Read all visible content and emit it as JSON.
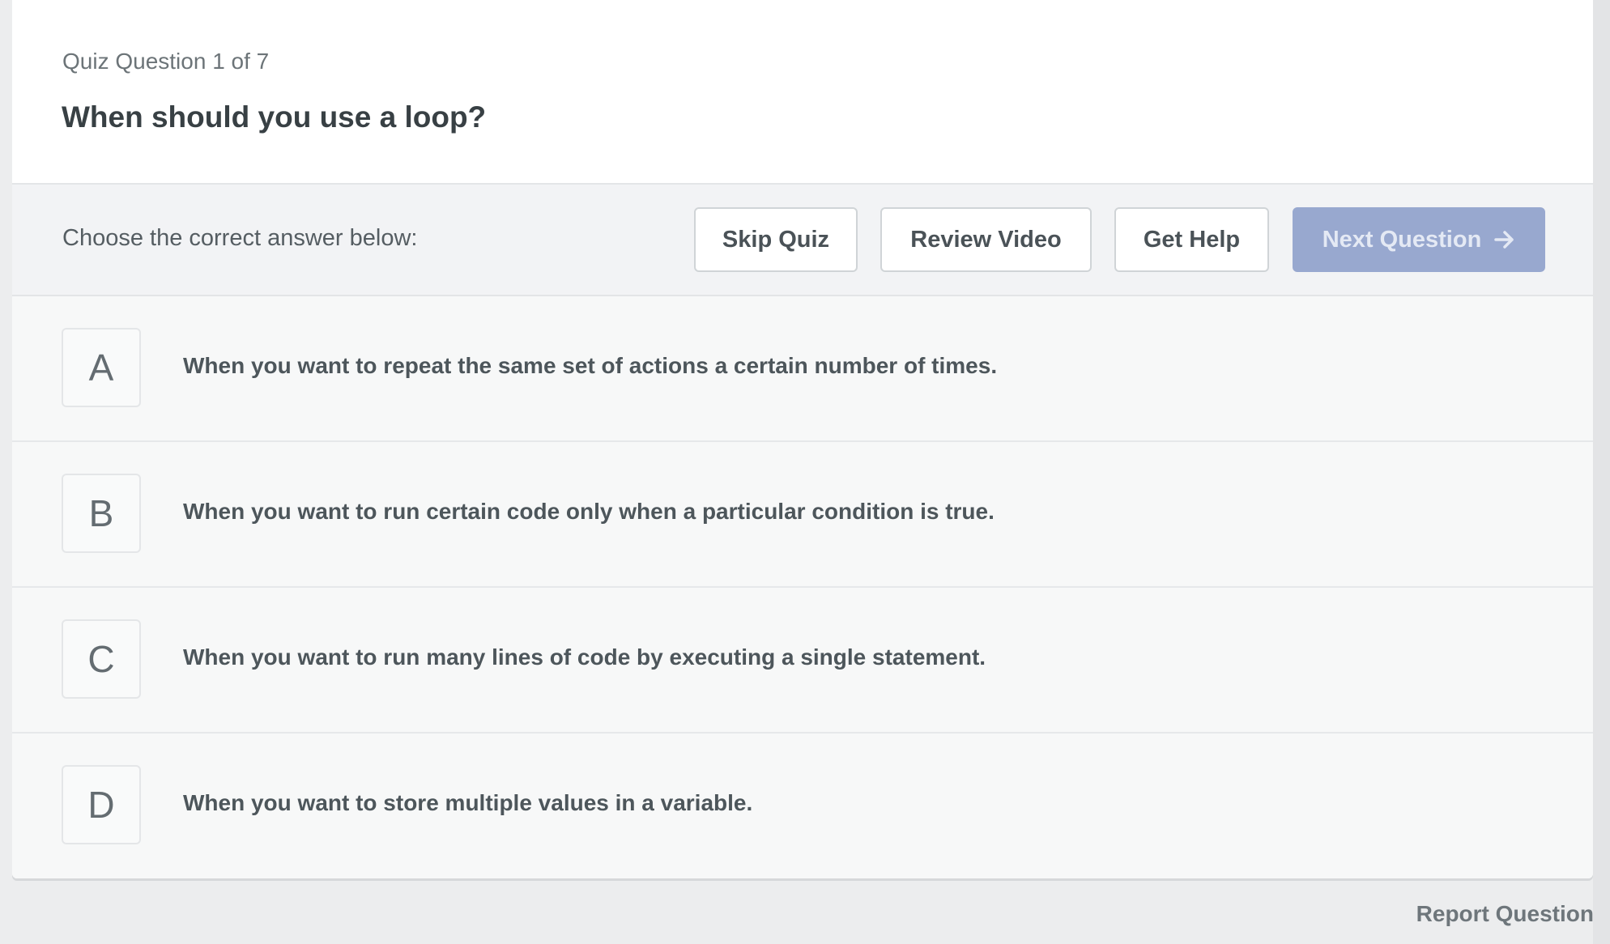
{
  "quiz": {
    "counter": "Quiz Question 1 of 7",
    "question": "When should you use a loop?"
  },
  "toolbar": {
    "prompt": "Choose the correct answer below:",
    "skip_label": "Skip Quiz",
    "review_label": "Review Video",
    "help_label": "Get Help",
    "next_label": "Next Question",
    "next_icon": "arrow-right-icon",
    "next_disabled": true
  },
  "options": [
    {
      "letter": "A",
      "text": "When you want to repeat the same set of actions a certain number of times."
    },
    {
      "letter": "B",
      "text": "When you want to run certain code only when a particular condition is true."
    },
    {
      "letter": "C",
      "text": "When you want to run many lines of code by executing a single statement."
    },
    {
      "letter": "D",
      "text": "When you want to store multiple values in a variable."
    }
  ],
  "footer": {
    "report_label": "Report Question"
  },
  "colors": {
    "next_button_disabled": "#98a8cf",
    "page_background": "#ecedee",
    "card_background": "#f7f8f8"
  }
}
